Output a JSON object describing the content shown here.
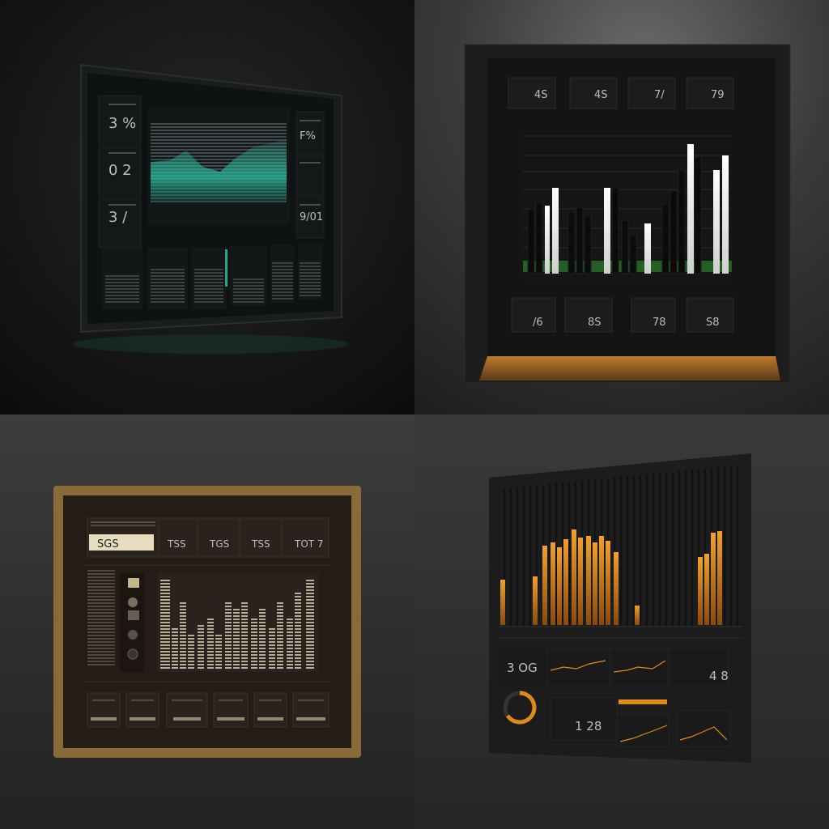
{
  "panel_1": {
    "left_stats": [
      "3 %",
      "0 2",
      "3 /"
    ],
    "right_stats": [
      "F%",
      "9/01"
    ]
  },
  "panel_2": {
    "top_stats": [
      "4S",
      "4S",
      "7/",
      "79"
    ],
    "bottom_stats": [
      "/6",
      "8S",
      "78",
      "S8"
    ]
  },
  "panel_3": {
    "header_selected": "SGS",
    "header_stats": [
      "TSS",
      "TGS",
      "TSS",
      "TOT 7"
    ]
  },
  "panel_4": {
    "readouts": [
      "3 OG",
      "1 28",
      "4 8"
    ]
  },
  "colors": {
    "teal": "#1fa88c",
    "green": "#2f9a2f",
    "amber": "#e08a1a",
    "gold_frame": "#8b6a3a",
    "cream": "#e8dcc0"
  }
}
